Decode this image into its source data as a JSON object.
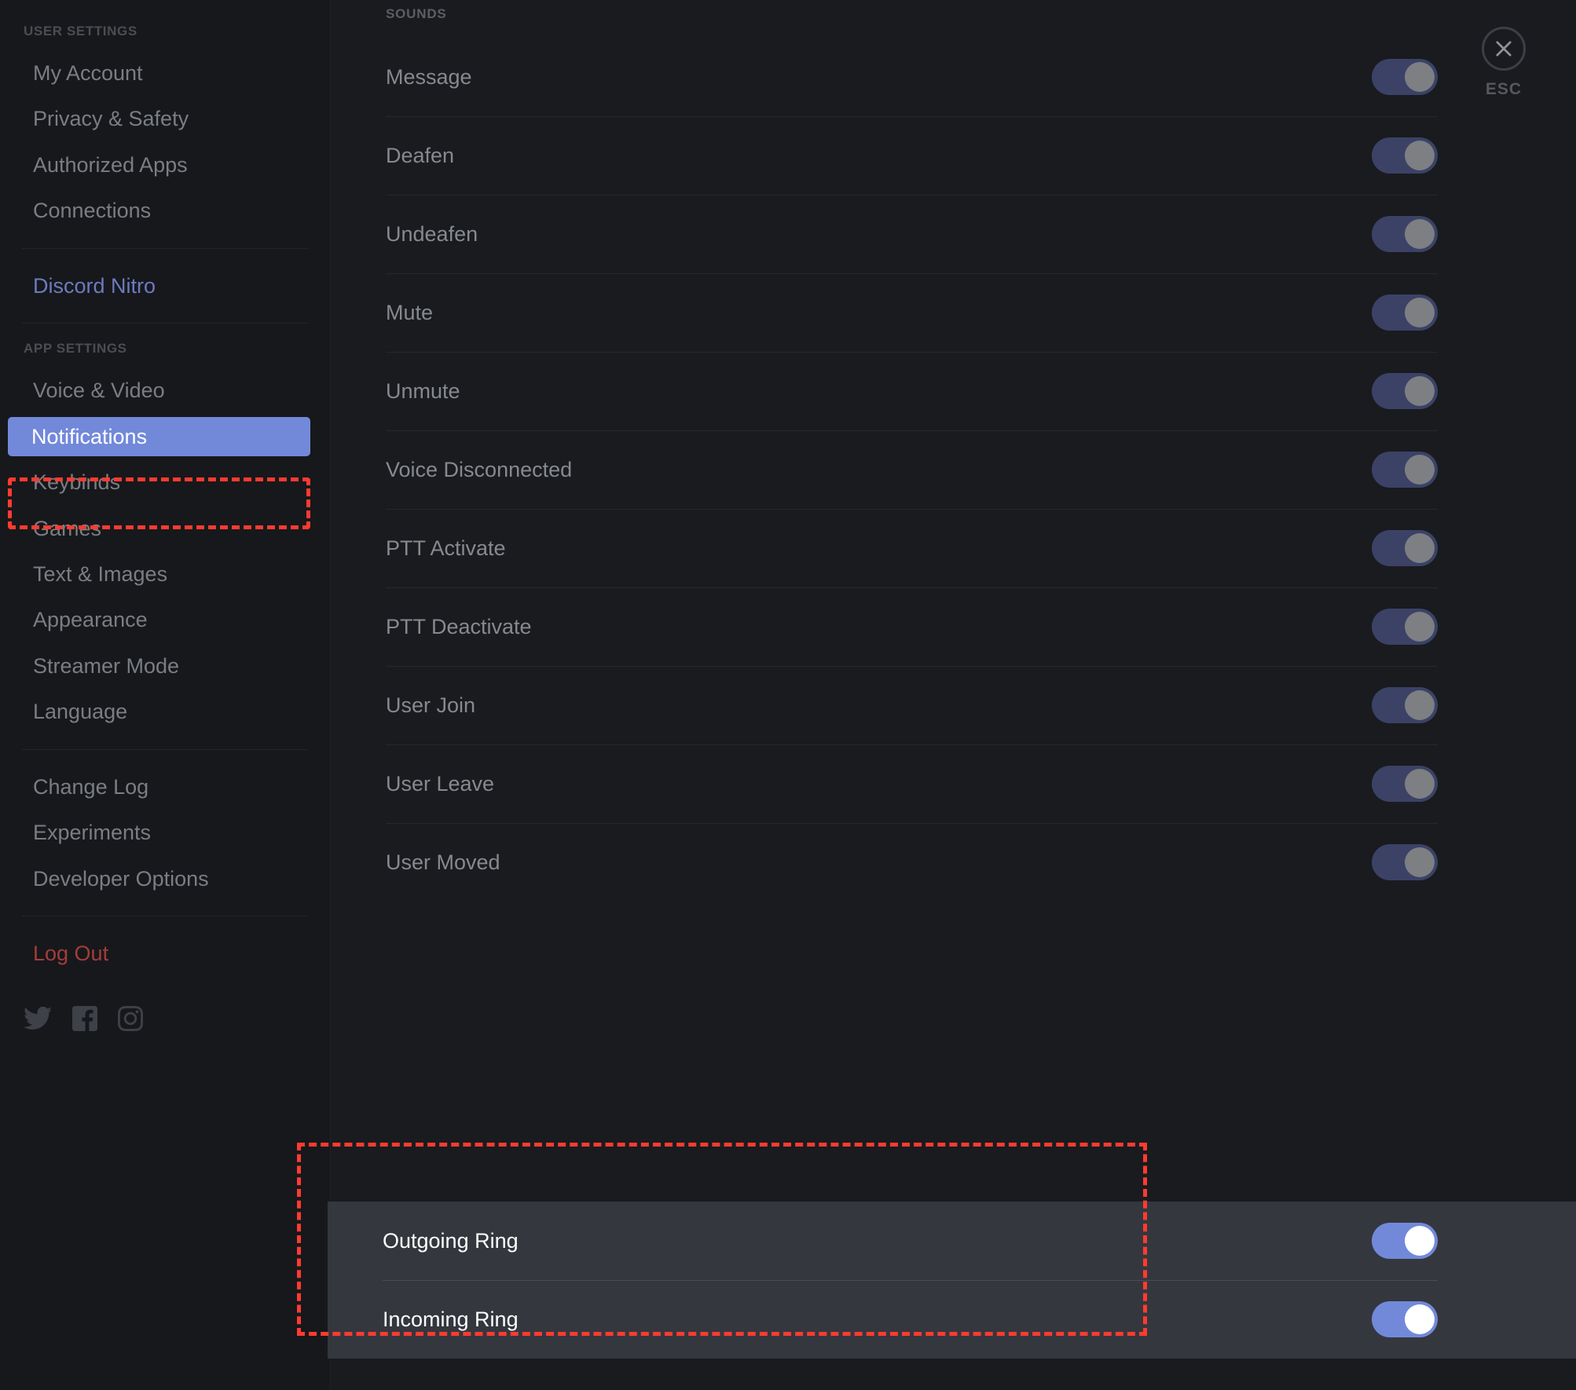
{
  "sidebar": {
    "user_settings_title": "USER SETTINGS",
    "user_items": [
      {
        "label": "My Account"
      },
      {
        "label": "Privacy & Safety"
      },
      {
        "label": "Authorized Apps"
      },
      {
        "label": "Connections"
      }
    ],
    "nitro": {
      "label": "Discord Nitro"
    },
    "app_settings_title": "APP SETTINGS",
    "app_items": [
      {
        "label": "Voice & Video",
        "active": false
      },
      {
        "label": "Notifications",
        "active": true
      },
      {
        "label": "Keybinds",
        "active": false
      },
      {
        "label": "Games",
        "active": false
      },
      {
        "label": "Text & Images",
        "active": false
      },
      {
        "label": "Appearance",
        "active": false
      },
      {
        "label": "Streamer Mode",
        "active": false
      },
      {
        "label": "Language",
        "active": false
      }
    ],
    "misc_items": [
      {
        "label": "Change Log"
      },
      {
        "label": "Experiments"
      },
      {
        "label": "Developer Options"
      }
    ],
    "logout": {
      "label": "Log Out"
    },
    "socials": [
      {
        "icon": "twitter-icon"
      },
      {
        "icon": "facebook-icon"
      },
      {
        "icon": "instagram-icon"
      }
    ]
  },
  "main": {
    "section_title": "SOUNDS",
    "sounds": [
      {
        "label": "Message",
        "enabled": true,
        "highlighted": false
      },
      {
        "label": "Deafen",
        "enabled": true,
        "highlighted": false
      },
      {
        "label": "Undeafen",
        "enabled": true,
        "highlighted": false
      },
      {
        "label": "Mute",
        "enabled": true,
        "highlighted": false
      },
      {
        "label": "Unmute",
        "enabled": true,
        "highlighted": false
      },
      {
        "label": "Voice Disconnected",
        "enabled": true,
        "highlighted": false
      },
      {
        "label": "PTT Activate",
        "enabled": true,
        "highlighted": false
      },
      {
        "label": "PTT Deactivate",
        "enabled": true,
        "highlighted": false
      },
      {
        "label": "User Join",
        "enabled": true,
        "highlighted": false
      },
      {
        "label": "User Leave",
        "enabled": true,
        "highlighted": false
      },
      {
        "label": "User Moved",
        "enabled": true,
        "highlighted": false
      }
    ],
    "ring_sounds": [
      {
        "label": "Outgoing Ring",
        "enabled": true,
        "highlighted": true
      },
      {
        "label": "Incoming Ring",
        "enabled": true,
        "highlighted": true
      }
    ]
  },
  "close": {
    "icon": "close-x-icon",
    "label": "ESC"
  },
  "colors": {
    "accent": "#7289da",
    "highlight_outline": "#ff3b30",
    "logout": "#a43c3c",
    "nitro": "#6d7ac0",
    "toggle_on_dim": "#3b4266",
    "panel_bg": "#34373e"
  }
}
